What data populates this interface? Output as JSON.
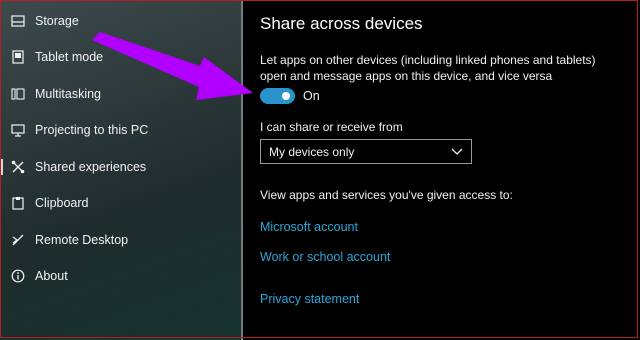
{
  "sidebar": {
    "items": [
      {
        "label": "Storage",
        "icon": "storage-icon"
      },
      {
        "label": "Tablet mode",
        "icon": "tablet-mode-icon"
      },
      {
        "label": "Multitasking",
        "icon": "multitasking-icon"
      },
      {
        "label": "Projecting to this PC",
        "icon": "projecting-icon"
      },
      {
        "label": "Shared experiences",
        "icon": "shared-experiences-icon",
        "active": true
      },
      {
        "label": "Clipboard",
        "icon": "clipboard-icon"
      },
      {
        "label": "Remote Desktop",
        "icon": "remote-desktop-icon"
      },
      {
        "label": "About",
        "icon": "info-icon"
      }
    ]
  },
  "main": {
    "title": "Share across devices",
    "description": "Let apps on other devices (including linked phones and tablets) open and message apps on this device, and vice versa",
    "toggle": {
      "label": "On",
      "checked": true
    },
    "share_label": "I can share or receive from",
    "dropdown": {
      "value": "My devices only"
    },
    "view_label": "View apps and services you've given access to:",
    "links": {
      "microsoft_account": "Microsoft account",
      "work_school_account": "Work or school account",
      "privacy_statement": "Privacy statement"
    }
  },
  "colors": {
    "accent": "#2a93c9",
    "link": "#2aa6d9",
    "annotation_arrow": "#b100ff",
    "background": "#000000"
  }
}
